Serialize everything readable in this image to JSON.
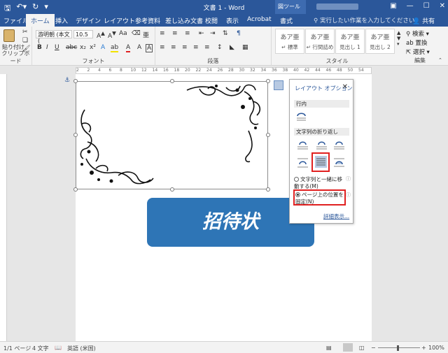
{
  "titlebar": {
    "title": "文書 1  -  Word",
    "contextual": "図ツール",
    "qat": {
      "save_icon": "save-icon",
      "undo_icon": "undo-icon",
      "redo_icon": "redo-icon"
    },
    "window_controls": {
      "minimize": "—",
      "maximize": "☐",
      "close": "✕"
    }
  },
  "tabs": [
    "ファイル",
    "ホーム",
    "挿入",
    "デザイン",
    "レイアウト",
    "参考資料",
    "差し込み文書",
    "校閲",
    "表示",
    "Acrobat",
    "書式"
  ],
  "active_tab": "ホーム",
  "tell_me": "実行したい作業を入力してください",
  "share": "共有",
  "ribbon": {
    "clipboard": {
      "label": "クリップボード",
      "paste": "貼り付け"
    },
    "font": {
      "label": "フォント",
      "font_name": "游明朝 (本文(",
      "font_size": "10.5"
    },
    "paragraph": {
      "label": "段落"
    },
    "styles": {
      "label": "スタイル",
      "items": [
        {
          "sample": "あア亜",
          "name": "標準"
        },
        {
          "sample": "あア亜",
          "name": "行間詰め"
        },
        {
          "sample": "あア亜",
          "name": "見出し 1"
        },
        {
          "sample": "あア亜",
          "name": "見出し 2"
        }
      ]
    },
    "editing": {
      "label": "編集",
      "find": "検索",
      "replace": "置換",
      "select": "選択"
    }
  },
  "ruler": {
    "ticks": [
      "2",
      "2",
      "4",
      "6",
      "8",
      "10",
      "12",
      "14",
      "16",
      "18",
      "20",
      "22",
      "24",
      "26",
      "28",
      "30",
      "32",
      "34",
      "36",
      "38",
      "40",
      "42",
      "44",
      "46",
      "48",
      "50",
      "54"
    ]
  },
  "document": {
    "banner_text": "招待状",
    "banner_color": "#2e75b6"
  },
  "layout_options": {
    "title": "レイアウト オプション",
    "close": "✕",
    "inline_section": "行内",
    "wrap_section": "文字列の折り返し",
    "move_with_text": "文字列と一緒に移動する(M)",
    "fix_position": "ページ上の位置を固定(N)",
    "more": "詳細表示..."
  },
  "status": {
    "page": "1/1 ページ",
    "words": "4 文字",
    "language": "英語 (米国)",
    "zoom": "100%"
  },
  "colors": {
    "accent": "#2b579a",
    "highlight": "#e02020"
  }
}
